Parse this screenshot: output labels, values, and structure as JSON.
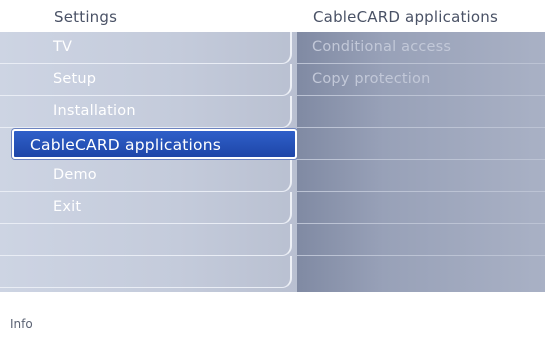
{
  "header": {
    "left_title": "Settings",
    "right_title": "CableCARD applications"
  },
  "menu": {
    "items": [
      {
        "label": "TV"
      },
      {
        "label": "Setup"
      },
      {
        "label": "Installation"
      },
      {
        "label": "CableCARD applications",
        "selected": true
      },
      {
        "label": "Demo"
      },
      {
        "label": "Exit"
      },
      {
        "label": ""
      },
      {
        "label": ""
      }
    ]
  },
  "submenu": {
    "items": [
      {
        "label": "Conditional access"
      },
      {
        "label": "Copy protection"
      },
      {
        "label": ""
      },
      {
        "label": ""
      },
      {
        "label": ""
      },
      {
        "label": ""
      },
      {
        "label": ""
      },
      {
        "label": ""
      }
    ]
  },
  "info": {
    "label": "Info"
  },
  "colors": {
    "selected_bg": "#2350b8",
    "left_panel": "#c4cbdb",
    "right_panel": "#98a1b8"
  }
}
